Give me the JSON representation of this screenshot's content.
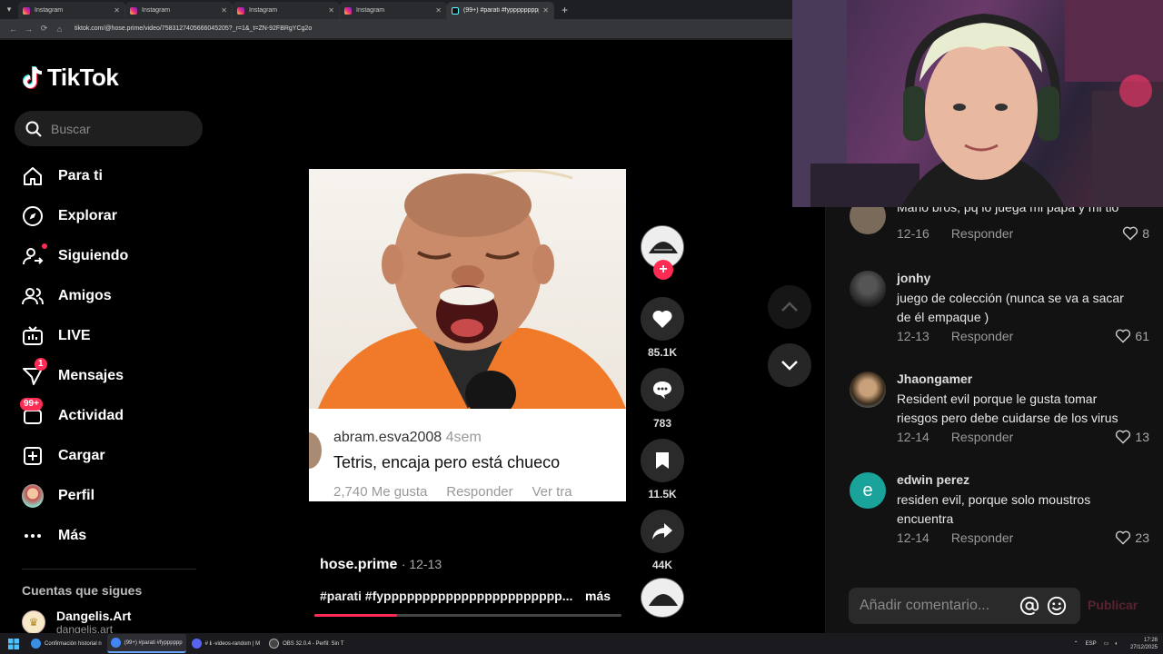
{
  "browser": {
    "tabs": [
      {
        "label": "Instagram",
        "active": false
      },
      {
        "label": "Instagram",
        "active": false
      },
      {
        "label": "Instagram",
        "active": false
      },
      {
        "label": "Instagram",
        "active": false
      },
      {
        "label": "(99+) #parati #fyppppppppppppp",
        "active": true
      }
    ],
    "url": "tiktok.com/@hose.prime/video/7583127405666045205?_r=1&_t=ZN-92FBRgYCg2o"
  },
  "sidebar": {
    "logo": "TikTok",
    "search_placeholder": "Buscar",
    "items": [
      {
        "label": "Para ti"
      },
      {
        "label": "Explorar"
      },
      {
        "label": "Siguiendo"
      },
      {
        "label": "Amigos"
      },
      {
        "label": "LIVE"
      },
      {
        "label": "Mensajes",
        "badge": "1"
      },
      {
        "label": "Actividad",
        "badge": "99+"
      },
      {
        "label": "Cargar"
      },
      {
        "label": "Perfil"
      },
      {
        "label": "Más"
      }
    ],
    "following_title": "Cuentas que sigues",
    "following": [
      {
        "name": "Dangelis.Art",
        "handle": "dangelis.art"
      }
    ]
  },
  "video": {
    "overlay_comment": {
      "user": "abram.esva2008",
      "time": "4sem",
      "text": "Tetris, encaja pero está chueco",
      "meta": "2,740 Me gusta     Responder     Ver tra"
    },
    "author": "hose.prime",
    "date": "· 12-13",
    "description": "#parati #fyppppppppppppppppppppppp...",
    "more": "más",
    "progress": 0.27
  },
  "actions": {
    "likes": "85.1K",
    "comments": "783",
    "saves": "11.5K",
    "shares": "44K"
  },
  "comments": [
    {
      "user": "",
      "text": "Mario bros, pq lo juega mi papá y mi tio",
      "date": "12-16",
      "reply": "Responder",
      "likes": "8"
    },
    {
      "user": "jonhy",
      "text": "juego de colección (nunca se va a sacar de él empaque )",
      "date": "12-13",
      "reply": "Responder",
      "likes": "61"
    },
    {
      "user": "Jhaongamer",
      "text": "Resident evil porque le gusta tomar riesgos pero debe cuidarse de los virus",
      "date": "12-14",
      "reply": "Responder",
      "likes": "13"
    },
    {
      "user": "edwin perez",
      "avatar_letter": "e",
      "text": "residen evil, porque solo moustros encuentra",
      "date": "12-14",
      "reply": "Responder",
      "likes": "23"
    }
  ],
  "compose": {
    "placeholder": "Añadir comentario...",
    "publish": "Publicar"
  },
  "taskbar": {
    "items": [
      {
        "label": "Confirmación historial n",
        "color": "#3b8ee6"
      },
      {
        "label": "(99+) #parati #fypppppp",
        "color": "#4285f4",
        "active": true
      },
      {
        "label": "# ℹ -videos-random | M",
        "color": "#5865f2"
      },
      {
        "label": "OBS 32.0.4 - Perfil: Sin T",
        "color": "#444"
      }
    ],
    "lang": "ESP",
    "time": "17:28",
    "date": "27/12/2025"
  },
  "colors": {
    "accent": "#fe2c55",
    "background": "#000000",
    "panel": "#121212"
  }
}
